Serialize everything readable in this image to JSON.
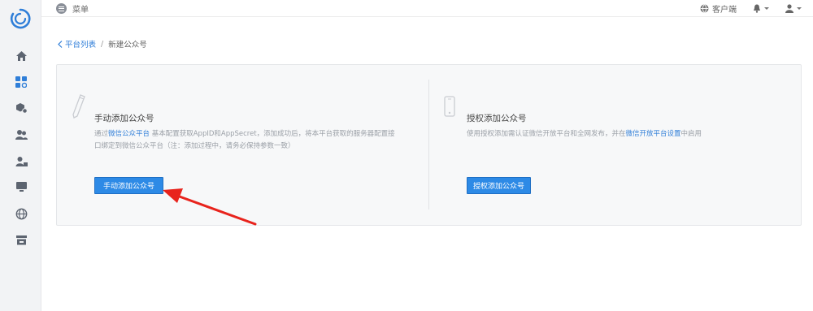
{
  "topbar": {
    "menu_label": "菜单",
    "client_label": "客户端"
  },
  "sidebar": {
    "items": [
      {
        "name": "home-icon"
      },
      {
        "name": "apps-icon"
      },
      {
        "name": "box-settings-icon"
      },
      {
        "name": "users-icon"
      },
      {
        "name": "user-lock-icon"
      },
      {
        "name": "monitor-icon"
      },
      {
        "name": "globe-icon"
      },
      {
        "name": "store-icon"
      }
    ]
  },
  "breadcrumb": {
    "parent": "平台列表",
    "separator": "/",
    "current": "新建公众号"
  },
  "manual": {
    "title": "手动添加公众号",
    "desc_prefix": "通过",
    "desc_link": "微信公众平台",
    "desc_rest_line1": "基本配置获取AppID和AppSecret，添加成功后，将本平台获取的服务器配置接",
    "desc_line2": "口绑定到微信公众平台（注：添加过程中，请务必保持参数一致）",
    "button": "手动添加公众号"
  },
  "auth": {
    "title": "授权添加公众号",
    "desc_prefix": "使用授权添加需认证微信开放平台和全网发布，并在",
    "desc_link": "微信开放平台设置",
    "desc_suffix": "中启用",
    "button": "授权添加公众号"
  },
  "colors": {
    "accent": "#2d8ae6",
    "link": "#2f7ed8",
    "annotation_arrow": "#e8231c"
  }
}
